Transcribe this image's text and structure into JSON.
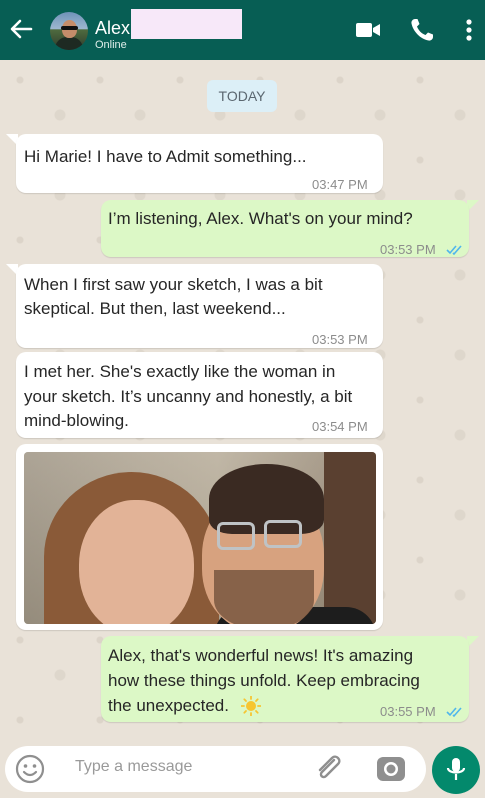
{
  "header": {
    "contact_name": "Alex",
    "status": "Online"
  },
  "chat": {
    "date_label": "TODAY",
    "messages": [
      {
        "direction": "in",
        "text": "Hi Marie! I have to Admit something...",
        "time": "03:47 PM"
      },
      {
        "direction": "out",
        "text": "I’m listening, Alex. What's on your mind?",
        "time": "03:53 PM",
        "read": true
      },
      {
        "direction": "in",
        "lines": [
          "When I first saw your sketch, I was a bit",
          "skeptical. But then, last weekend..."
        ],
        "time": "03:53 PM"
      },
      {
        "direction": "in",
        "lines": [
          "I met her. She's exactly like the woman in",
          "your sketch. It’s uncanny and honestly, a bit",
          "mind-blowing."
        ],
        "time": "03:54 PM"
      },
      {
        "direction": "in",
        "type": "photo"
      },
      {
        "direction": "out",
        "lines": [
          "Alex, that's wonderful news! It's amazing",
          "how these things unfold. Keep embracing",
          "the unexpected."
        ],
        "time": "03:55 PM",
        "read": true
      }
    ]
  },
  "composer": {
    "placeholder": "Type a message"
  },
  "icons": {
    "back": "arrow-left-icon",
    "video": "video-call-icon",
    "call": "phone-icon",
    "menu": "more-vert-icon",
    "emoji": "emoji-icon",
    "attach": "paperclip-icon",
    "camera": "camera-icon",
    "mic": "microphone-icon",
    "read_receipt": "double-check-icon",
    "sun_emoji": "sun-emoji"
  },
  "colors": {
    "header": "#075e54",
    "outgoing_bubble": "#dcf8c6",
    "incoming_bubble": "#ffffff",
    "read_ticks": "#4fb6ec",
    "mic_button": "#03896c"
  }
}
